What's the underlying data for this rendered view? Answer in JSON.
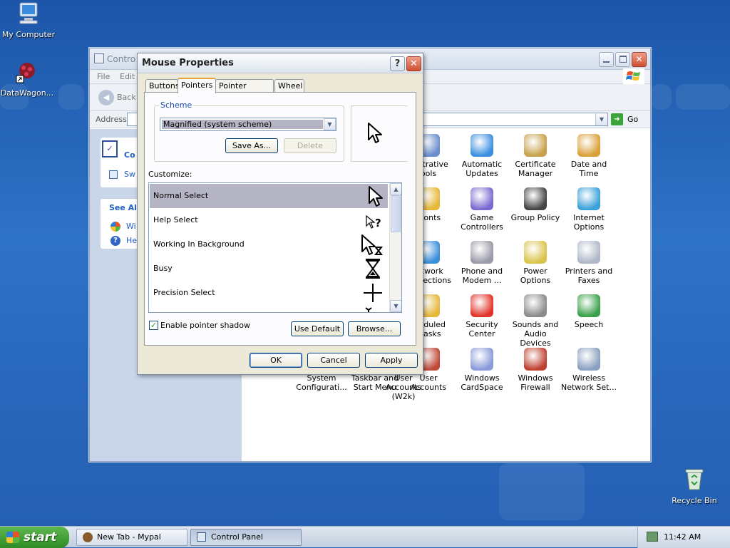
{
  "desktop": {
    "icons": {
      "my_computer": "My Computer",
      "datawagon": "DataWagon...",
      "recycle_bin": "Recycle Bin"
    }
  },
  "control_panel": {
    "title": "Contro",
    "menu": {
      "file": "File",
      "edit": "Edit"
    },
    "toolbar": {
      "back": "Back"
    },
    "address": {
      "label": "Address",
      "go": "Go"
    },
    "left": {
      "section_title": "Co",
      "switch_link": "Sw",
      "see_also": "See Al",
      "link1": "Wi",
      "link2": "He"
    },
    "items": [
      {
        "label": "...istrative\nools",
        "icon": "admin-tools-icon"
      },
      {
        "label": "Automatic\nUpdates",
        "icon": "automatic-updates-icon"
      },
      {
        "label": "Certificate\nManager",
        "icon": "certificate-icon"
      },
      {
        "label": "Date and Time",
        "icon": "date-time-icon"
      },
      {
        "label": "...onts",
        "icon": "fonts-icon"
      },
      {
        "label": "Game\nControllers",
        "icon": "game-controller-icon"
      },
      {
        "label": "Group Policy",
        "icon": "group-policy-icon"
      },
      {
        "label": "Internet\nOptions",
        "icon": "internet-options-icon"
      },
      {
        "label": "...twork\n...nnections",
        "icon": "network-icon"
      },
      {
        "label": "Phone and\nModem ...",
        "icon": "phone-modem-icon"
      },
      {
        "label": "Power Options",
        "icon": "power-options-icon"
      },
      {
        "label": "Printers and\nFaxes",
        "icon": "printer-icon"
      },
      {
        "label": "...eduled\n...asks",
        "icon": "scheduled-tasks-icon"
      },
      {
        "label": "Security\nCenter",
        "icon": "security-shield-icon"
      },
      {
        "label": "Sounds and\nAudio Devices",
        "icon": "speaker-icon"
      },
      {
        "label": "Speech",
        "icon": "speech-icon"
      },
      {
        "label": "System\nConfiguratі...",
        "icon": "system-config-icon"
      },
      {
        "label": "Taskbar and\nStart Menu",
        "icon": "taskbar-icon"
      },
      {
        "label": "User Accounts",
        "icon": "user-accounts-icon"
      },
      {
        "label": "User Accounts\n(W2k)",
        "icon": "user-accounts-w2k-icon"
      },
      {
        "label": "Windows\nCardSpace",
        "icon": "cardspace-icon"
      },
      {
        "label": "Windows\nFirewall",
        "icon": "firewall-icon"
      },
      {
        "label": "Wireless\nNetwork Set...",
        "icon": "wireless-icon"
      }
    ]
  },
  "dialog": {
    "title": "Mouse Properties",
    "help": "?",
    "tabs": [
      "Buttons",
      "Pointers",
      "Pointer Options",
      "Wheel"
    ],
    "scheme_group": "Scheme",
    "scheme_value": "Magnified (system scheme)",
    "save_as": "Save As...",
    "delete": "Delete",
    "customize_label": "Customize:",
    "pointers": [
      {
        "label": "Normal Select"
      },
      {
        "label": "Help Select"
      },
      {
        "label": "Working In Background"
      },
      {
        "label": "Busy"
      },
      {
        "label": "Precision Select"
      }
    ],
    "shadow_label": "Enable pointer shadow",
    "use_default": "Use Default",
    "browse": "Browse...",
    "ok": "OK",
    "cancel": "Cancel",
    "apply": "Apply"
  },
  "taskbar": {
    "start": "start",
    "tasks": [
      "New Tab - Mypal",
      "Control Panel"
    ],
    "clock": "11:42 AM"
  }
}
